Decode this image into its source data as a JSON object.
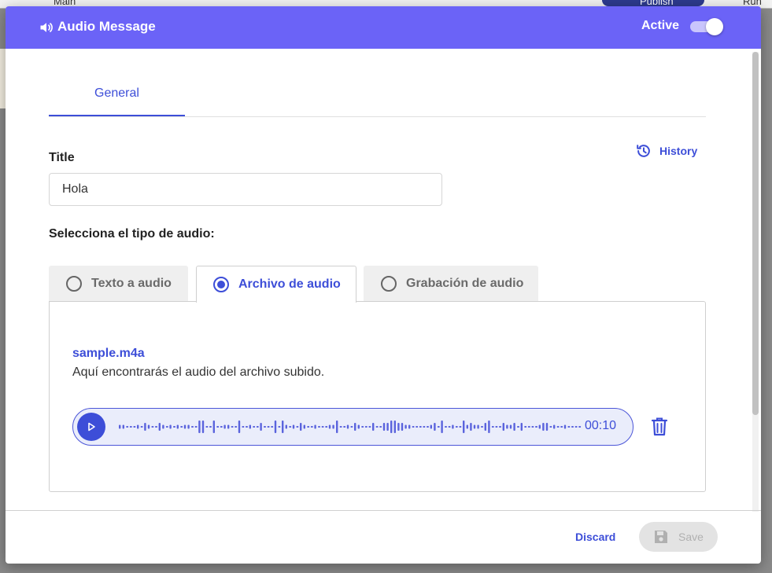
{
  "background": {
    "labels": [
      "Main",
      "Publish",
      "Run"
    ]
  },
  "modal": {
    "title": "Audio Message",
    "icon": "speaker-icon",
    "active_label": "Active",
    "active": true
  },
  "tabs": [
    {
      "label": "General",
      "selected": true
    }
  ],
  "history": {
    "label": "History",
    "icon": "history-icon"
  },
  "form": {
    "title_label": "Title",
    "title_value": "Hola",
    "audio_type_label": "Selecciona el tipo de audio:"
  },
  "audio_types": [
    {
      "label": "Texto a audio",
      "selected": false
    },
    {
      "label": "Archivo de audio",
      "selected": true
    },
    {
      "label": "Grabación de audio",
      "selected": false
    }
  ],
  "file": {
    "name": "sample.m4a",
    "description": "Aquí encontrarás el audio del archivo subido."
  },
  "player": {
    "time": "00:10",
    "play_icon": "play-icon",
    "delete_icon": "trash-icon"
  },
  "footer": {
    "discard_label": "Discard",
    "save_label": "Save",
    "save_icon": "floppy-disk-icon"
  },
  "colors": {
    "header": "#6b63f7",
    "accent": "#3d4ed8",
    "player_bg": "#eaedfb"
  }
}
